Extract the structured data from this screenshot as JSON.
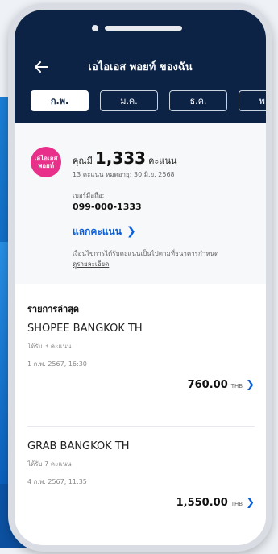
{
  "header": {
    "title": "เอไอเอส พอยท์ ของฉัน",
    "tabs": [
      "ก.พ.",
      "ม.ค.",
      "ธ.ค.",
      "พ.ย."
    ]
  },
  "points": {
    "logo_line1": "เอไอเอส",
    "logo_line2": "พอยท์",
    "prefix": "คุณมี",
    "value": "1,333",
    "unit": "คะแนน",
    "expiring": "13 คะแนน หมดอายุ: 30 มิ.ย. 2568",
    "phone_label": "เบอร์มือถือ:",
    "phone_number": "099-000-1333",
    "redeem_label": "แลกคะแนน",
    "condition_text": "เงื่อนไขการได้รับคะแนนเป็นไปตามที่ธนาคารกำหนด",
    "condition_link": "ดูรายละเอียด"
  },
  "recent": {
    "title": "รายการล่าสุด",
    "items": [
      {
        "merchant": "SHOPEE BANGKOK TH",
        "earned": "ได้รับ 3 คะแนน",
        "date": "1 ก.พ. 2567, 16:30",
        "amount": "760.00",
        "currency": "THB"
      },
      {
        "merchant": "GRAB BANGKOK TH",
        "earned": "ได้รับ 7 คะแนน",
        "date": "4 ก.พ. 2567, 11:35",
        "amount": "1,550.00",
        "currency": "THB"
      }
    ]
  },
  "colors": {
    "header_bg": "#0d2345",
    "accent": "#0a5fd6",
    "brand_pink": "#e8308a"
  }
}
